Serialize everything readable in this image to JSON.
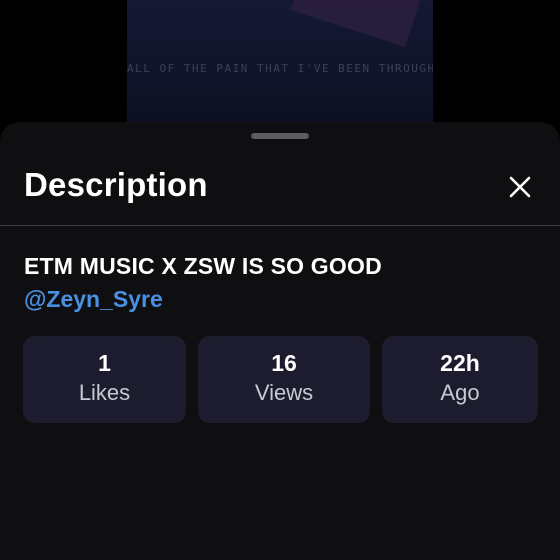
{
  "background_video": {
    "caption": "ALL OF THE PAIN THAT I'VE BEEN THROUGH"
  },
  "sheet": {
    "title": "Description",
    "close_icon": "close-icon"
  },
  "description": {
    "text": "ETM MUSIC X ZSW IS SO GOOD",
    "mention": "@Zeyn_Syre"
  },
  "stats": [
    {
      "value": "1",
      "label": "Likes"
    },
    {
      "value": "16",
      "label": "Views"
    },
    {
      "value": "22h",
      "label": "Ago"
    }
  ],
  "colors": {
    "sheet_background": "#0f0f11",
    "card_background": "#1c1c2e",
    "mention": "#4a90e2",
    "text": "#ffffff"
  }
}
